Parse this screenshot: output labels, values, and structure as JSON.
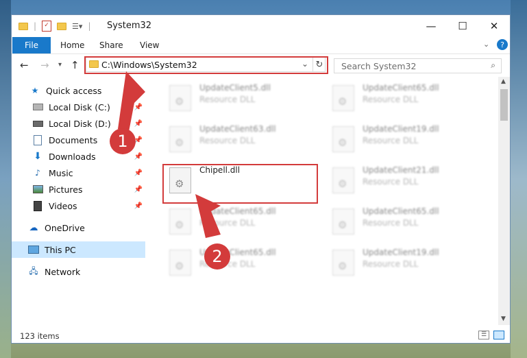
{
  "window": {
    "title": "System32"
  },
  "ribbon": {
    "file": "File",
    "home": "Home",
    "share": "Share",
    "view": "View"
  },
  "address": {
    "path": "C:\\Windows\\System32"
  },
  "search": {
    "placeholder": "Search System32"
  },
  "sidebar": {
    "items": [
      {
        "label": "Quick access",
        "icon": "star-icon"
      },
      {
        "label": "Local Disk (C:)",
        "icon": "drive-icon"
      },
      {
        "label": "Local Disk (D:)",
        "icon": "drive-icon"
      },
      {
        "label": "Documents",
        "icon": "documents-icon"
      },
      {
        "label": "Downloads",
        "icon": "download-arrow-icon"
      },
      {
        "label": "Music",
        "icon": "music-icon"
      },
      {
        "label": "Pictures",
        "icon": "pictures-icon"
      },
      {
        "label": "Videos",
        "icon": "videos-icon"
      },
      {
        "label": "OneDrive",
        "icon": "cloud-icon"
      },
      {
        "label": "This PC",
        "icon": "computer-icon"
      },
      {
        "label": "Network",
        "icon": "network-icon"
      }
    ]
  },
  "files": [
    {
      "name": "UpdateClient5.dll",
      "desc": "Resource DLL"
    },
    {
      "name": "UpdateClient65.dll",
      "desc": "Resource DLL"
    },
    {
      "name": "UpdateClient63.dll",
      "desc": "Resource DLL"
    },
    {
      "name": "UpdateClient19.dll",
      "desc": "Resource DLL"
    },
    {
      "name": "Chipell.dll",
      "desc": ""
    },
    {
      "name": "UpdateClient21.dll",
      "desc": "Resource DLL"
    },
    {
      "name": "UpdateClient65.dll",
      "desc": "Resource DLL"
    },
    {
      "name": "UpdateClient65.dll",
      "desc": "Resource DLL"
    },
    {
      "name": "UpdateClient65.dll",
      "desc": "Resource DLL"
    },
    {
      "name": "UpdateClient19.dll",
      "desc": "Resource DLL"
    }
  ],
  "status": {
    "count": "123 items"
  },
  "markers": {
    "one": "1",
    "two": "2"
  },
  "colors": {
    "accent": "#1979ca",
    "annotation": "#d33b3b",
    "selection": "#cce8ff"
  }
}
